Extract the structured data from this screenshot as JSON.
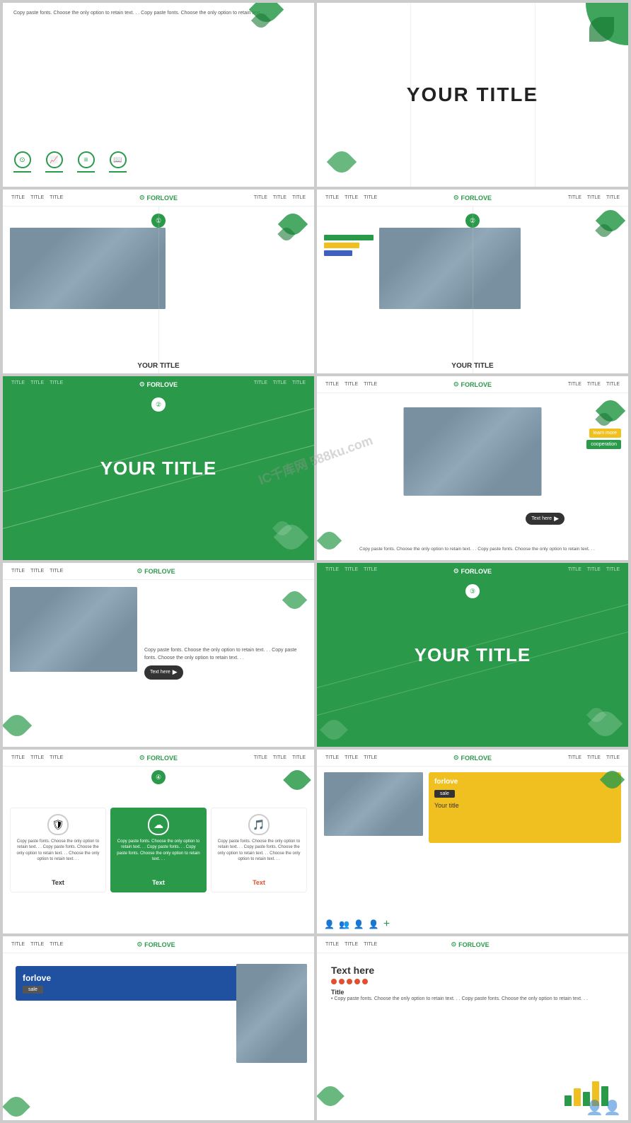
{
  "watermark": "IC千库网 588ku.com",
  "brand": {
    "logo": "⊙",
    "name": "FORLOVE"
  },
  "nav": {
    "items": [
      "TITLE",
      "TITLE",
      "TITLE",
      "TITLE",
      "TITLE",
      "TITLE",
      "TITLE"
    ]
  },
  "slides": [
    {
      "id": "slide-top-left",
      "type": "text-icons",
      "body_text": "Copy paste fonts. Choose the only option to retain text. . . Copy paste fonts. Choose the only option to retain text. . .",
      "icons": [
        "⊙",
        "📈",
        "≡",
        "📖"
      ]
    },
    {
      "id": "slide-top-right",
      "type": "hero-title",
      "title": "YOUR TITLE"
    },
    {
      "id": "slide-2-left",
      "type": "nav-photo",
      "num": "①",
      "subtitle": "YOUR TITLE",
      "photo": "meeting"
    },
    {
      "id": "slide-2-right",
      "type": "nav-photo-bars",
      "num": "②",
      "subtitle": "YOUR TITLE",
      "photo": "team"
    },
    {
      "id": "slide-3-left",
      "type": "green-hero",
      "title": "YOUR TITLE",
      "num": "②"
    },
    {
      "id": "slide-3-right",
      "type": "handshake",
      "photo": "handshake",
      "badge1": "learn more",
      "badge2": "cooperation",
      "btn": "Text here",
      "body_text": "Copy paste fonts. Choose the only option to retain text. . . Copy paste fonts. Choose the only option to retain text. . ."
    },
    {
      "id": "slide-4-left",
      "type": "photo-text",
      "photo": "team2",
      "btn": "Text here",
      "body_text": "Copy paste fonts. Choose the only option to retain text. . . Copy paste fonts. Choose the only option to retain text. . ."
    },
    {
      "id": "slide-4-right",
      "type": "green-hero-2",
      "title": "YOUR TITLE",
      "num": "③"
    },
    {
      "id": "slide-5-left",
      "type": "shields",
      "num": "④",
      "cards": [
        {
          "label": "Text",
          "text": "Copy paste fonts. Choose the only option to retain text. . . Copy paste fonts. Choose the only option to retain text. . . Choose the only option to retain text. . .",
          "active": false,
          "icon": "🛡"
        },
        {
          "label": "Text",
          "text": "Copy paste fonts. Choose the only option to retain text. . . Copy paste fonts. . . Copy paste fonts. Choose the only option to retain text. . .",
          "active": true,
          "icon": "☁"
        },
        {
          "label": "Text",
          "text": "Copy paste fonts. Choose the only option to retain text. . . Copy paste fonts. Choose the only option to retain text. . . Choose the only option to retain text. . .",
          "active": false,
          "icon": "🎵"
        }
      ]
    },
    {
      "id": "slide-5-right",
      "type": "yellow-panel",
      "forlove": "forlove",
      "sale": "sale",
      "your_title": "Your title",
      "photo": "team3",
      "icons": [
        "👤",
        "👥",
        "👤",
        "👤"
      ]
    },
    {
      "id": "slide-6-left",
      "type": "blue-panel",
      "forlove": "forlove",
      "sale": "sale",
      "photo": "team4"
    },
    {
      "id": "slide-6-right",
      "type": "text-here",
      "title": "Text here",
      "subtitle": "Title",
      "body_text": "Copy paste fonts. Choose the only option to retain text. . . Copy paste fonts. Choose the only option to retain text. . .",
      "bullet": "Copy paste fonts. Choose the only option to retain text. . . Copy paste fonts. Choose the only option to retain text. . ."
    }
  ],
  "colors": {
    "green": "#2a9a4a",
    "dark_green": "#1a7a35",
    "yellow": "#f0c020",
    "blue": "#2050a0",
    "red": "#e05030"
  }
}
